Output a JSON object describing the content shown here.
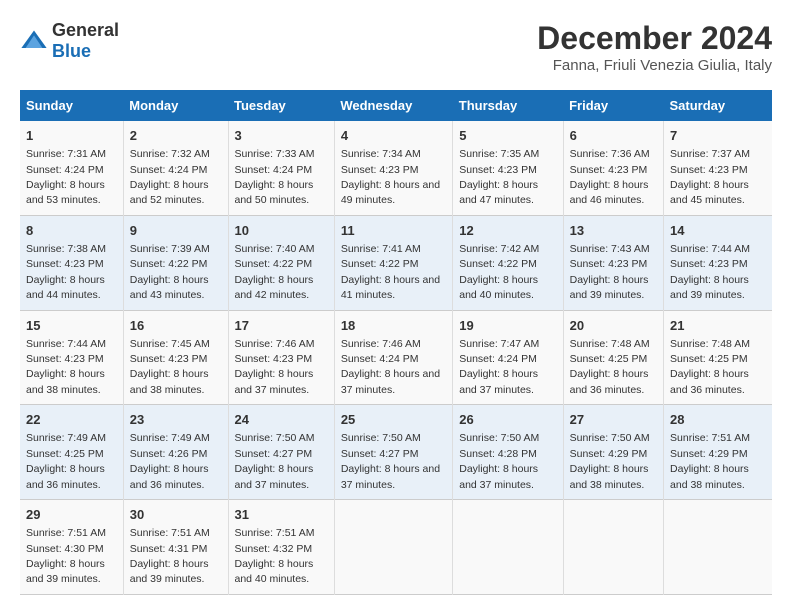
{
  "logo": {
    "general": "General",
    "blue": "Blue"
  },
  "title": "December 2024",
  "subtitle": "Fanna, Friuli Venezia Giulia, Italy",
  "days_header": [
    "Sunday",
    "Monday",
    "Tuesday",
    "Wednesday",
    "Thursday",
    "Friday",
    "Saturday"
  ],
  "weeks": [
    [
      {
        "day": "1",
        "sunrise": "Sunrise: 7:31 AM",
        "sunset": "Sunset: 4:24 PM",
        "daylight": "Daylight: 8 hours and 53 minutes."
      },
      {
        "day": "2",
        "sunrise": "Sunrise: 7:32 AM",
        "sunset": "Sunset: 4:24 PM",
        "daylight": "Daylight: 8 hours and 52 minutes."
      },
      {
        "day": "3",
        "sunrise": "Sunrise: 7:33 AM",
        "sunset": "Sunset: 4:24 PM",
        "daylight": "Daylight: 8 hours and 50 minutes."
      },
      {
        "day": "4",
        "sunrise": "Sunrise: 7:34 AM",
        "sunset": "Sunset: 4:23 PM",
        "daylight": "Daylight: 8 hours and 49 minutes."
      },
      {
        "day": "5",
        "sunrise": "Sunrise: 7:35 AM",
        "sunset": "Sunset: 4:23 PM",
        "daylight": "Daylight: 8 hours and 47 minutes."
      },
      {
        "day": "6",
        "sunrise": "Sunrise: 7:36 AM",
        "sunset": "Sunset: 4:23 PM",
        "daylight": "Daylight: 8 hours and 46 minutes."
      },
      {
        "day": "7",
        "sunrise": "Sunrise: 7:37 AM",
        "sunset": "Sunset: 4:23 PM",
        "daylight": "Daylight: 8 hours and 45 minutes."
      }
    ],
    [
      {
        "day": "8",
        "sunrise": "Sunrise: 7:38 AM",
        "sunset": "Sunset: 4:23 PM",
        "daylight": "Daylight: 8 hours and 44 minutes."
      },
      {
        "day": "9",
        "sunrise": "Sunrise: 7:39 AM",
        "sunset": "Sunset: 4:22 PM",
        "daylight": "Daylight: 8 hours and 43 minutes."
      },
      {
        "day": "10",
        "sunrise": "Sunrise: 7:40 AM",
        "sunset": "Sunset: 4:22 PM",
        "daylight": "Daylight: 8 hours and 42 minutes."
      },
      {
        "day": "11",
        "sunrise": "Sunrise: 7:41 AM",
        "sunset": "Sunset: 4:22 PM",
        "daylight": "Daylight: 8 hours and 41 minutes."
      },
      {
        "day": "12",
        "sunrise": "Sunrise: 7:42 AM",
        "sunset": "Sunset: 4:22 PM",
        "daylight": "Daylight: 8 hours and 40 minutes."
      },
      {
        "day": "13",
        "sunrise": "Sunrise: 7:43 AM",
        "sunset": "Sunset: 4:23 PM",
        "daylight": "Daylight: 8 hours and 39 minutes."
      },
      {
        "day": "14",
        "sunrise": "Sunrise: 7:44 AM",
        "sunset": "Sunset: 4:23 PM",
        "daylight": "Daylight: 8 hours and 39 minutes."
      }
    ],
    [
      {
        "day": "15",
        "sunrise": "Sunrise: 7:44 AM",
        "sunset": "Sunset: 4:23 PM",
        "daylight": "Daylight: 8 hours and 38 minutes."
      },
      {
        "day": "16",
        "sunrise": "Sunrise: 7:45 AM",
        "sunset": "Sunset: 4:23 PM",
        "daylight": "Daylight: 8 hours and 38 minutes."
      },
      {
        "day": "17",
        "sunrise": "Sunrise: 7:46 AM",
        "sunset": "Sunset: 4:23 PM",
        "daylight": "Daylight: 8 hours and 37 minutes."
      },
      {
        "day": "18",
        "sunrise": "Sunrise: 7:46 AM",
        "sunset": "Sunset: 4:24 PM",
        "daylight": "Daylight: 8 hours and 37 minutes."
      },
      {
        "day": "19",
        "sunrise": "Sunrise: 7:47 AM",
        "sunset": "Sunset: 4:24 PM",
        "daylight": "Daylight: 8 hours and 37 minutes."
      },
      {
        "day": "20",
        "sunrise": "Sunrise: 7:48 AM",
        "sunset": "Sunset: 4:25 PM",
        "daylight": "Daylight: 8 hours and 36 minutes."
      },
      {
        "day": "21",
        "sunrise": "Sunrise: 7:48 AM",
        "sunset": "Sunset: 4:25 PM",
        "daylight": "Daylight: 8 hours and 36 minutes."
      }
    ],
    [
      {
        "day": "22",
        "sunrise": "Sunrise: 7:49 AM",
        "sunset": "Sunset: 4:25 PM",
        "daylight": "Daylight: 8 hours and 36 minutes."
      },
      {
        "day": "23",
        "sunrise": "Sunrise: 7:49 AM",
        "sunset": "Sunset: 4:26 PM",
        "daylight": "Daylight: 8 hours and 36 minutes."
      },
      {
        "day": "24",
        "sunrise": "Sunrise: 7:50 AM",
        "sunset": "Sunset: 4:27 PM",
        "daylight": "Daylight: 8 hours and 37 minutes."
      },
      {
        "day": "25",
        "sunrise": "Sunrise: 7:50 AM",
        "sunset": "Sunset: 4:27 PM",
        "daylight": "Daylight: 8 hours and 37 minutes."
      },
      {
        "day": "26",
        "sunrise": "Sunrise: 7:50 AM",
        "sunset": "Sunset: 4:28 PM",
        "daylight": "Daylight: 8 hours and 37 minutes."
      },
      {
        "day": "27",
        "sunrise": "Sunrise: 7:50 AM",
        "sunset": "Sunset: 4:29 PM",
        "daylight": "Daylight: 8 hours and 38 minutes."
      },
      {
        "day": "28",
        "sunrise": "Sunrise: 7:51 AM",
        "sunset": "Sunset: 4:29 PM",
        "daylight": "Daylight: 8 hours and 38 minutes."
      }
    ],
    [
      {
        "day": "29",
        "sunrise": "Sunrise: 7:51 AM",
        "sunset": "Sunset: 4:30 PM",
        "daylight": "Daylight: 8 hours and 39 minutes."
      },
      {
        "day": "30",
        "sunrise": "Sunrise: 7:51 AM",
        "sunset": "Sunset: 4:31 PM",
        "daylight": "Daylight: 8 hours and 39 minutes."
      },
      {
        "day": "31",
        "sunrise": "Sunrise: 7:51 AM",
        "sunset": "Sunset: 4:32 PM",
        "daylight": "Daylight: 8 hours and 40 minutes."
      },
      {
        "day": "",
        "sunrise": "",
        "sunset": "",
        "daylight": ""
      },
      {
        "day": "",
        "sunrise": "",
        "sunset": "",
        "daylight": ""
      },
      {
        "day": "",
        "sunrise": "",
        "sunset": "",
        "daylight": ""
      },
      {
        "day": "",
        "sunrise": "",
        "sunset": "",
        "daylight": ""
      }
    ]
  ]
}
